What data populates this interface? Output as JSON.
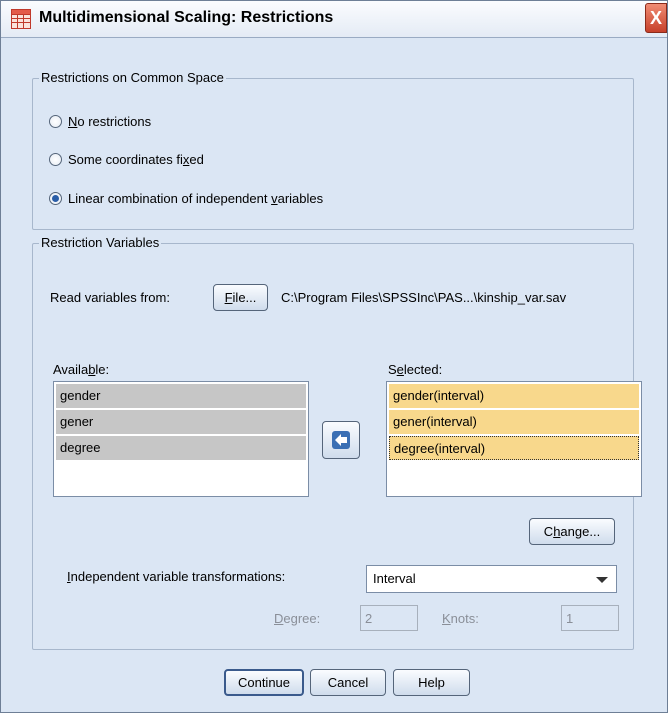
{
  "window": {
    "title": "Multidimensional Scaling: Restrictions",
    "close_label": "X"
  },
  "common_space": {
    "legend": "Restrictions on Common Space",
    "options": [
      {
        "pre": "",
        "mn": "N",
        "post": "o restrictions",
        "checked": false
      },
      {
        "pre": "Some coordinates fi",
        "mn": "x",
        "post": "ed",
        "checked": false
      },
      {
        "pre": "Linear combination of independent ",
        "mn": "v",
        "post": "ariables",
        "checked": true
      }
    ]
  },
  "restriction_vars": {
    "legend": "Restriction Variables",
    "read_label": "Read variables from:",
    "file_button": {
      "mn": "F",
      "post": "ile..."
    },
    "file_path": "C:\\Program Files\\SPSSInc\\PAS...\\kinship_var.sav",
    "available_label": {
      "pre": "Availa",
      "mn": "b",
      "post": "le:"
    },
    "available_items": [
      "gender",
      "gener",
      "degree"
    ],
    "selected_label": {
      "pre": "S",
      "mn": "e",
      "post": "lected:"
    },
    "selected_items": [
      "gender(interval)",
      "gener(interval)",
      "degree(interval)"
    ],
    "change_button": {
      "pre": "C",
      "mn": "h",
      "post": "ange..."
    },
    "transform_label": {
      "pre": "",
      "mn": "I",
      "post": "ndependent variable transformations:"
    },
    "transform_value": "Interval",
    "degree_label": {
      "pre": "",
      "mn": "D",
      "post": "egree:"
    },
    "degree_value": "2",
    "knots_label": {
      "pre": "",
      "mn": "K",
      "post": "nots:"
    },
    "knots_value": "1"
  },
  "footer": {
    "continue": "Continue",
    "cancel": "Cancel",
    "help": "Help"
  },
  "colors": {
    "dialog_bg": "#dbe6f4",
    "available_highlight": "#c6c6c6",
    "selected_highlight": "#f8d88c"
  }
}
